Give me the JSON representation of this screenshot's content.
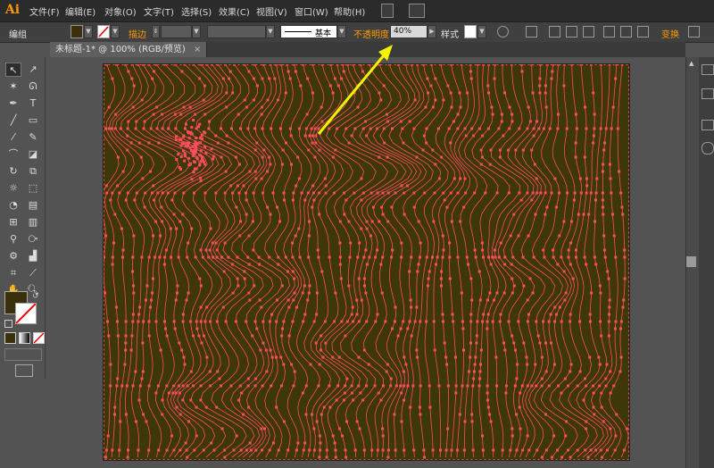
{
  "app": {
    "logo": "Ai"
  },
  "menu": [
    "文件(F)",
    "编辑(E)",
    "对象(O)",
    "文字(T)",
    "选择(S)",
    "效果(C)",
    "视图(V)",
    "窗口(W)",
    "帮助(H)"
  ],
  "control_bar": {
    "selection_label": "编组",
    "stroke_label": "描边",
    "brush_label": "基本",
    "opacity_label": "不透明度",
    "opacity_value": "40%",
    "style_label": "样式",
    "transform_label": "变换"
  },
  "document": {
    "tab_label": "未标题-1* @ 100% (RGB/预览)",
    "close_glyph": "×"
  },
  "colors": {
    "accent": "#ff9a00",
    "artboard_fill": "#3d3709",
    "path_color": "#ff4d5e",
    "annotation_arrow": "#f3f300",
    "fill_swatch": "#3a300b"
  },
  "tools": [
    "selection-tool",
    "direct-selection-tool",
    "magic-wand-tool",
    "lasso-tool",
    "pen-tool",
    "type-tool",
    "line-tool",
    "rectangle-tool",
    "paintbrush-tool",
    "pencil-tool",
    "blob-brush-tool",
    "eraser-tool",
    "rotate-tool",
    "scale-tool",
    "warp-tool",
    "free-transform-tool",
    "shape-builder-tool",
    "perspective-grid-tool",
    "mesh-tool",
    "gradient-tool",
    "eyedropper-tool",
    "blend-tool",
    "symbol-sprayer-tool",
    "column-graph-tool",
    "artboard-tool",
    "slice-tool",
    "hand-tool",
    "zoom-tool"
  ]
}
